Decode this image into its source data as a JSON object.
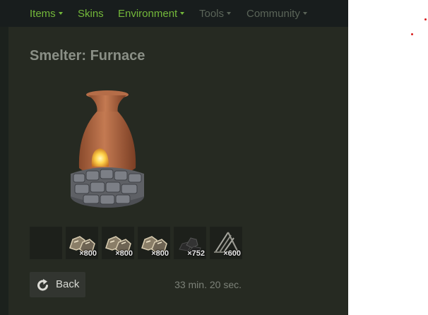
{
  "nav": {
    "items": [
      {
        "label": "Items",
        "dropdown": true,
        "color": "#73b83a"
      },
      {
        "label": "Skins",
        "dropdown": false,
        "color": "#73b83a"
      },
      {
        "label": "Environment",
        "dropdown": true,
        "color": "#73b83a"
      },
      {
        "label": "Tools",
        "dropdown": true,
        "color": "#5a6458"
      },
      {
        "label": "Community",
        "dropdown": true,
        "color": "#5a6458"
      }
    ]
  },
  "page": {
    "title": "Smelter: Furnace",
    "image_icon": "furnace-image"
  },
  "slots": [
    {
      "icon": "empty-slot",
      "quantity": ""
    },
    {
      "icon": "metal-ore-icon",
      "quantity": "×800"
    },
    {
      "icon": "metal-ore-icon",
      "quantity": "×800"
    },
    {
      "icon": "metal-ore-icon",
      "quantity": "×800"
    },
    {
      "icon": "charcoal-icon",
      "quantity": "×752"
    },
    {
      "icon": "wood-icon",
      "quantity": "×600"
    }
  ],
  "actions": {
    "back_label": "Back",
    "back_icon": "refresh-arrow-icon"
  },
  "status": {
    "time": "33 min. 20 sec."
  },
  "colors": {
    "nav_active": "#73b83a",
    "nav_muted": "#5a6458",
    "panel_bg": "#262a22"
  }
}
